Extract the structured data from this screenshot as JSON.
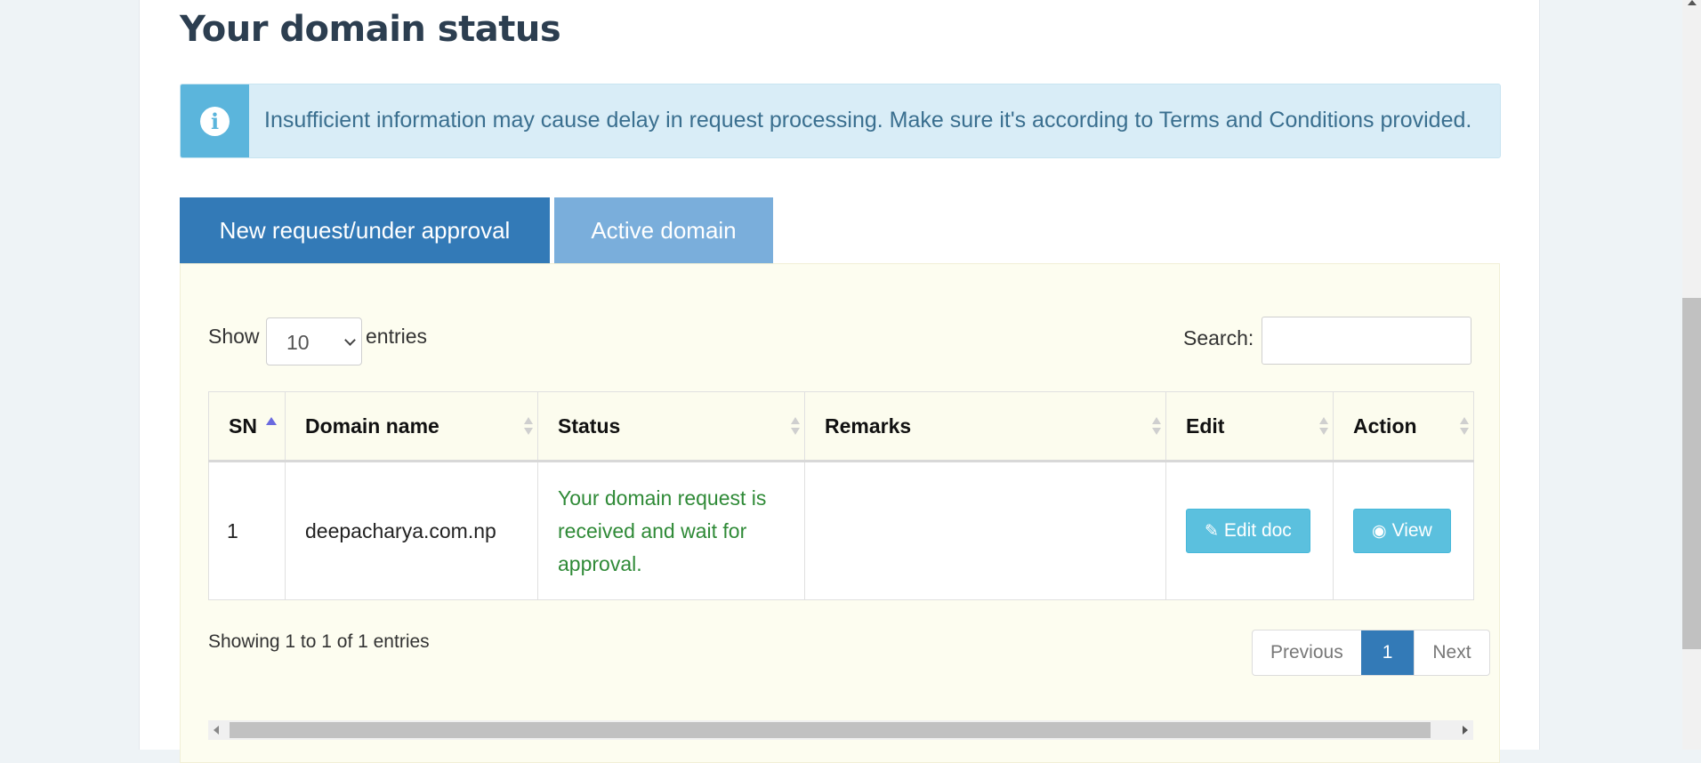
{
  "page": {
    "title": "Your domain status"
  },
  "alert": {
    "icon": "info-icon",
    "text": "Insufficient information may cause delay in request processing. Make sure it's according to Terms and Conditions provided."
  },
  "tabs": [
    {
      "label": "New request/under approval",
      "active": true
    },
    {
      "label": "Active domain",
      "active": false
    }
  ],
  "length_control": {
    "show_label": "Show",
    "selected": "10",
    "entries_label": "entries"
  },
  "search": {
    "label": "Search:",
    "value": ""
  },
  "table": {
    "columns": [
      "SN",
      "Domain name",
      "Status",
      "Remarks",
      "Edit",
      "Action"
    ],
    "rows": [
      {
        "sn": "1",
        "domain": "deepacharya.com.np",
        "status": "Your domain request is received and wait for approval.",
        "remarks": "",
        "edit_label": "Edit doc",
        "action_label": "View"
      }
    ]
  },
  "footer": {
    "info": "Showing 1 to 1 of 1 entries"
  },
  "pagination": {
    "previous": "Previous",
    "current": "1",
    "next": "Next"
  },
  "colors": {
    "primary": "#337ab7",
    "info": "#5bc0de",
    "success_text": "#2f8a37",
    "alert_bg": "#d9edf7"
  }
}
